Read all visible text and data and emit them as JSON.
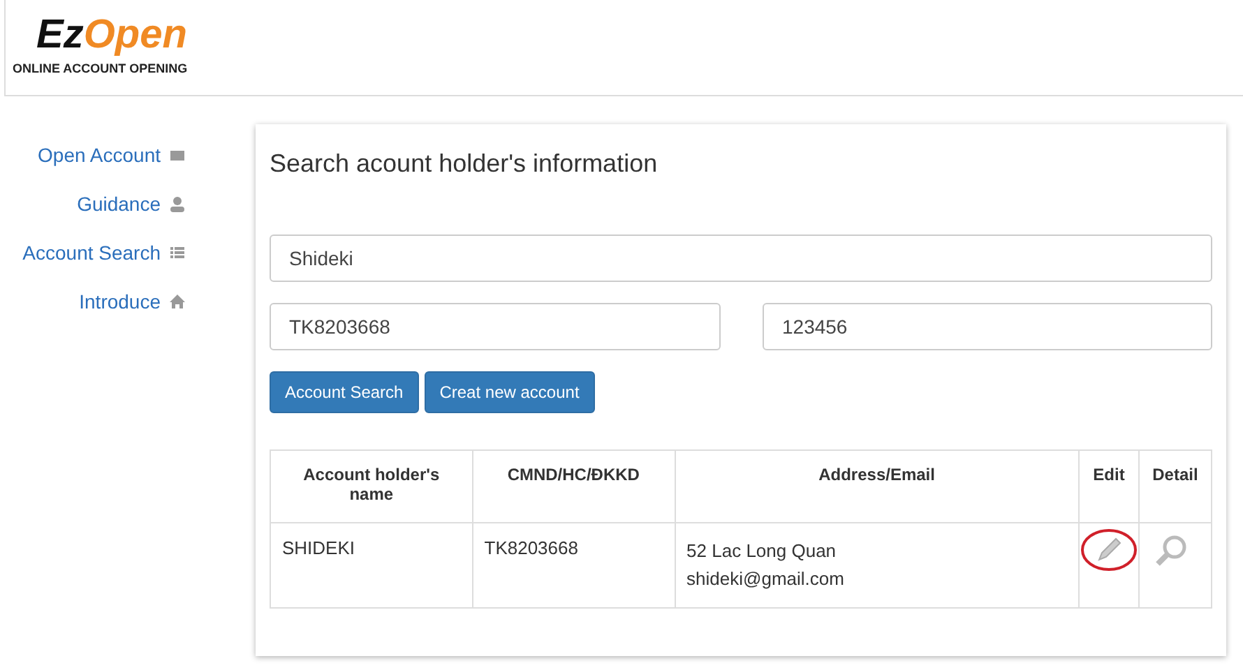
{
  "logo": {
    "part_1": "Ez",
    "part_2": "Open",
    "tagline": "ONLINE ACCOUNT OPENING"
  },
  "sidebar": {
    "items": [
      {
        "label": "Open Account",
        "kind": "mail"
      },
      {
        "label": "Guidance",
        "kind": "user"
      },
      {
        "label": "Account Search",
        "kind": "list"
      },
      {
        "label": "Introduce",
        "kind": "home"
      }
    ]
  },
  "panel": {
    "title": "Search acount holder's information",
    "name_field": {
      "value": "Shideki"
    },
    "account_field": {
      "value": "TK8203668"
    },
    "code_field": {
      "value": "123456"
    },
    "buttons": [
      "Account Search",
      "Creat new account"
    ],
    "table": {
      "columns": [
        "Account holder's name",
        "CMND/HC/ĐKKD",
        "Address/Email",
        "Edit",
        "Detail"
      ],
      "rows": [
        {
          "name": "SHIDEKI",
          "id": "TK8203668",
          "address": "52 Lac Long Quan",
          "email": "shideki@gmail.com",
          "edit_highlighted": true
        }
      ]
    }
  }
}
